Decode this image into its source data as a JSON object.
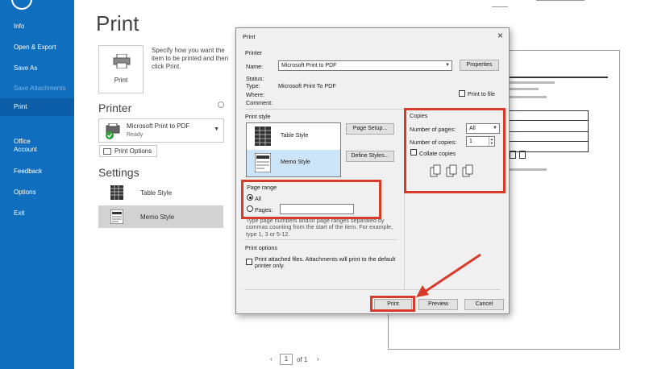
{
  "nav": {
    "items": [
      {
        "label": "Info"
      },
      {
        "label": "Open & Export"
      },
      {
        "label": "Save As"
      },
      {
        "label": "Save Attachments"
      },
      {
        "label": "Print"
      },
      {
        "label": "Office\nAccount"
      },
      {
        "label": "Feedback"
      },
      {
        "label": "Options"
      },
      {
        "label": "Exit"
      }
    ]
  },
  "backstage": {
    "title": "Print",
    "print_button_label": "Print",
    "print_description": "Specify how you want the item to be printed and then click Print.",
    "printer_heading": "Printer",
    "printer_name": "Microsoft Print to PDF",
    "printer_status": "Ready",
    "print_options_label": "Print Options",
    "settings_heading": "Settings",
    "styles": [
      {
        "label": "Table Style"
      },
      {
        "label": "Memo Style"
      }
    ]
  },
  "pager": {
    "current": "1",
    "of_label": "of 1"
  },
  "dialog": {
    "title": "Print",
    "printer_group": "Printer",
    "name_label": "Name:",
    "name_value": "Microsoft Print to PDF",
    "properties_label": "Properties",
    "status_label": "Status:",
    "type_label": "Type:",
    "type_value": "Microsoft Print To PDF",
    "where_label": "Where:",
    "comment_label": "Comment:",
    "print_to_file_label": "Print to file",
    "print_style_group": "Print style",
    "styles": [
      {
        "label": "Table Style"
      },
      {
        "label": "Memo Style"
      }
    ],
    "page_setup_label": "Page Setup...",
    "define_styles_label": "Define Styles...",
    "copies_group": "Copies",
    "num_pages_label": "Number of pages:",
    "num_pages_value": "All",
    "num_copies_label": "Number of copies:",
    "num_copies_value": "1",
    "collate_label": "Collate copies",
    "page_range_group": "Page range",
    "all_label": "All",
    "pages_label": "Pages:",
    "range_help": "Type page numbers and/or page ranges separated by commas counting from the start of the item.  For example, type 1, 3 or 5-12.",
    "print_options_group": "Print options",
    "attached_label": "Print attached files.  Attachments will print to the default printer only.",
    "print_label": "Print",
    "preview_label": "Preview",
    "cancel_label": "Cancel"
  },
  "colors": {
    "nav_bg": "#106ebe",
    "highlight": "#d93b2b"
  }
}
